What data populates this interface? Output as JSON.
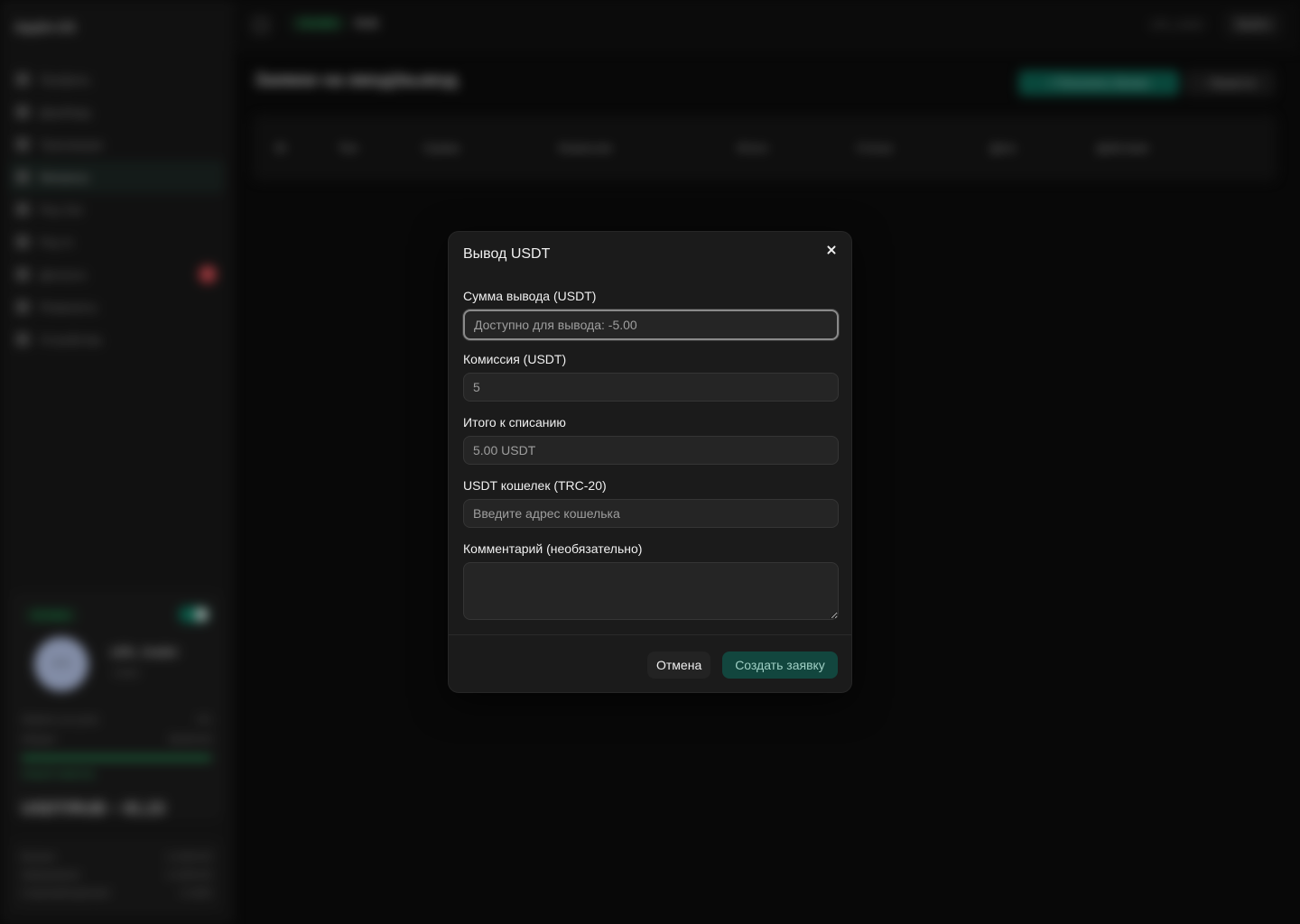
{
  "app": {
    "brand": "Apple-US",
    "nav": [
      {
        "label": "Профиль"
      },
      {
        "label": "Дашборд"
      },
      {
        "label": "Транзакции"
      },
      {
        "label": "Финансы",
        "active": true
      },
      {
        "label": "Pay Out"
      },
      {
        "label": "Pay In"
      },
      {
        "label": "Диспуты",
        "badge": "3"
      },
      {
        "label": "Реквизиты"
      },
      {
        "label": "Устройства"
      }
    ],
    "profile": {
      "status": "Активен",
      "avatar_text": "• •",
      "username": "x2fx_trader",
      "role": "trader",
      "stats": [
        {
          "label": "Лимиты за сутки",
          "value": "0/1"
        },
        {
          "label": "Оборот",
          "value": "$1200.00"
        }
      ],
      "limit_link": "Новый лимитов",
      "limit_progress": 1.0,
      "rate": "USDT/RUB ~ 81.23"
    },
    "balances": [
      {
        "label": "Баланс",
        "value": "0.1000.00"
      },
      {
        "label": "Заморожено",
        "value": "0.1000.00"
      },
      {
        "label": "Страховой депозит",
        "value": "0.1000"
      }
    ],
    "topbar": {
      "status": "Онлайн",
      "currency": "RUB",
      "user": "x2fx_trader",
      "logout": "Выйти"
    },
    "page_title": "Заявки на ввод/вывод",
    "actions": {
      "topup": "+ Пополнить баланс",
      "withdraw": "↑ Вывести"
    },
    "table_headers": [
      "ID",
      "Тип",
      "Сумма",
      "Комиссия",
      "Итого",
      "Статус",
      "Дата",
      "Действия"
    ]
  },
  "modal": {
    "title": "Вывод USDT",
    "amount_label": "Сумма вывода (USDT)",
    "amount_placeholder": "Доступно для вывода: -5.00",
    "fee_label": "Комиссия (USDT)",
    "fee_value": "5",
    "total_label": "Итого к списанию",
    "total_value": "5.00 USDT",
    "wallet_label": "USDT кошелек (TRC-20)",
    "wallet_placeholder": "Введите адрес кошелька",
    "comment_label": "Комментарий (необязательно)",
    "comment_value": "",
    "cancel": "Отмена",
    "submit": "Создать заявку"
  }
}
